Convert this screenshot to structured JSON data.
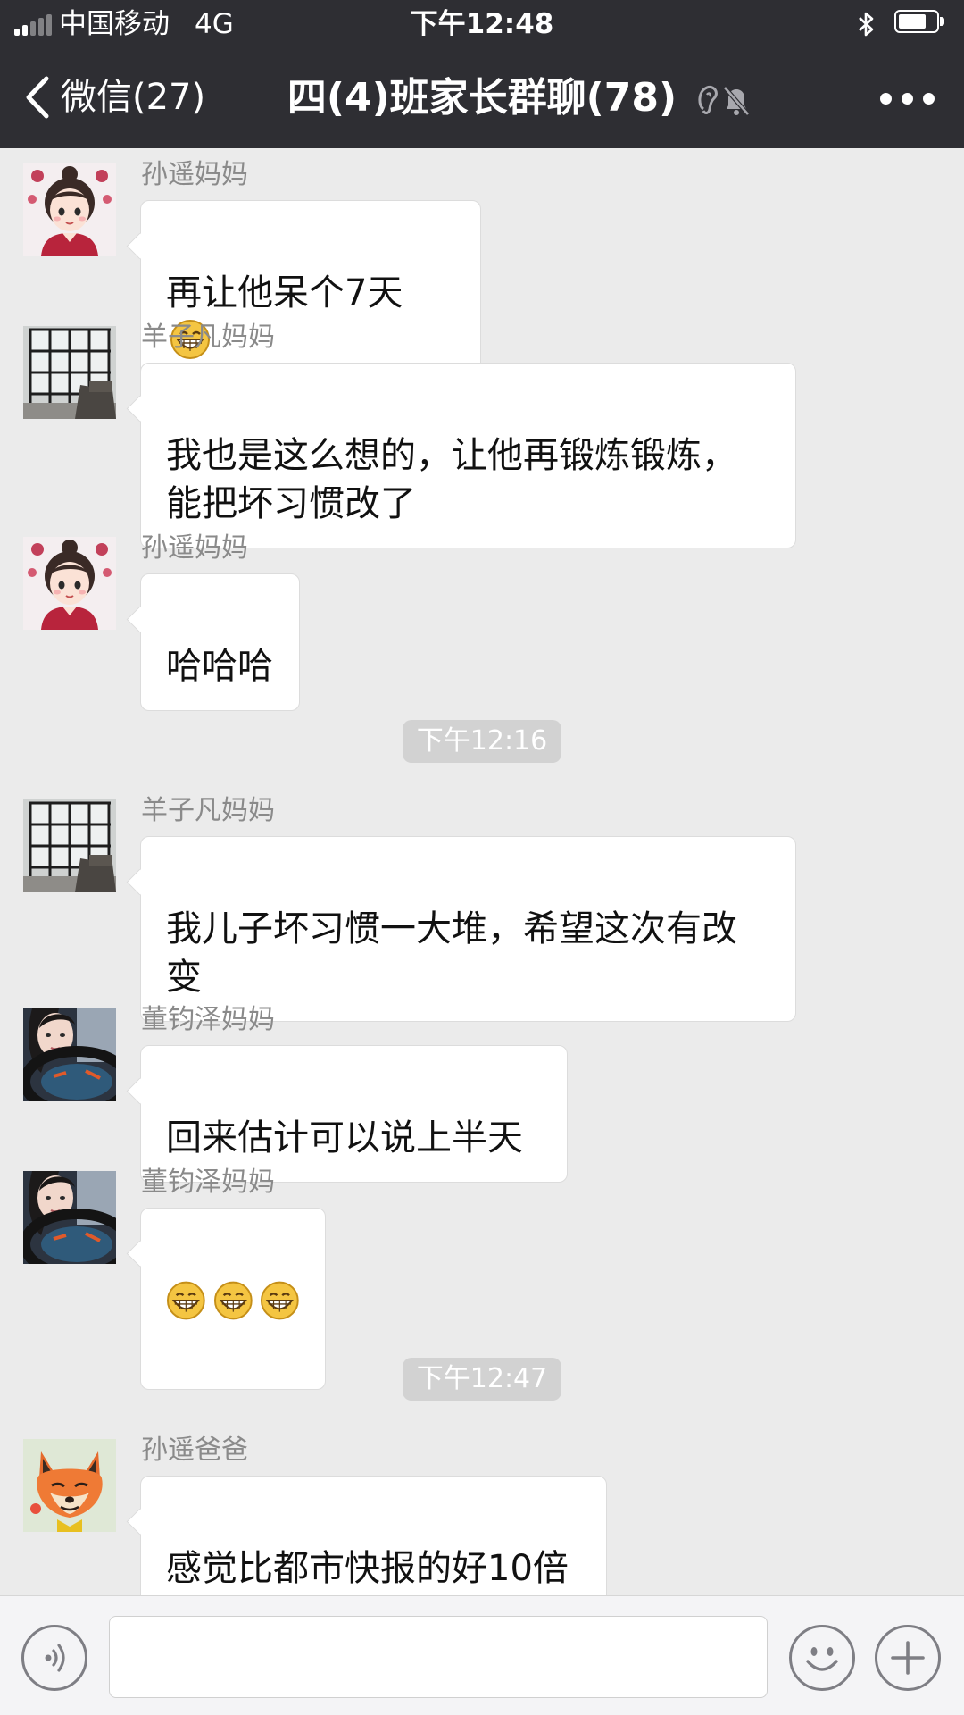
{
  "status_bar": {
    "carrier": "中国移动",
    "network": "4G",
    "time": "下午12:48",
    "signal_bars_filled": 2,
    "battery_level": 0.75,
    "icons": [
      "signal-icon",
      "bluetooth-icon",
      "battery-icon"
    ]
  },
  "nav": {
    "back_label": "微信(27)",
    "title": "四(4)班家长群聊(78)",
    "icons": [
      "back-chevron-icon",
      "ear-icon",
      "mute-bell-icon",
      "more-icon"
    ]
  },
  "messages": [
    {
      "sender": "孙遥妈妈",
      "text": "再让他呆个7天",
      "emoji_count": 1,
      "avatar": "cartoon-girl-avatar"
    },
    {
      "sender": "羊子凡妈妈",
      "text": "我也是这么想的，让他再锻炼锻炼，\n能把坏习惯改了",
      "emoji_count": 0,
      "avatar": "window-room-avatar"
    },
    {
      "sender": "孙遥妈妈",
      "text": "哈哈哈",
      "emoji_count": 0,
      "avatar": "cartoon-girl-avatar"
    },
    {
      "sender": "羊子凡妈妈",
      "text": "我儿子坏习惯一大堆，希望这次有改\n变",
      "emoji_count": 0,
      "avatar": "window-room-avatar"
    },
    {
      "sender": "董钧泽妈妈",
      "text": "回来估计可以说上半天",
      "emoji_count": 0,
      "avatar": "woman-car-avatar"
    },
    {
      "sender": "董钧泽妈妈",
      "text": "",
      "emoji_count": 3,
      "avatar": "woman-car-avatar"
    },
    {
      "sender": "孙遥爸爸",
      "text": "感觉比都市快报的好10倍",
      "emoji_count": 0,
      "avatar": "cartoon-fox-avatar"
    }
  ],
  "timestamps": [
    "下午12:16",
    "下午12:47"
  ],
  "input_bar": {
    "placeholder": "",
    "icons": [
      "voice-icon",
      "emoji-icon",
      "plus-icon"
    ]
  },
  "colors": {
    "bar_background": "#2e2e33",
    "chat_background": "#ebebeb",
    "bubble": "#ffffff",
    "timestamp_pill": "#d2d2d2"
  }
}
